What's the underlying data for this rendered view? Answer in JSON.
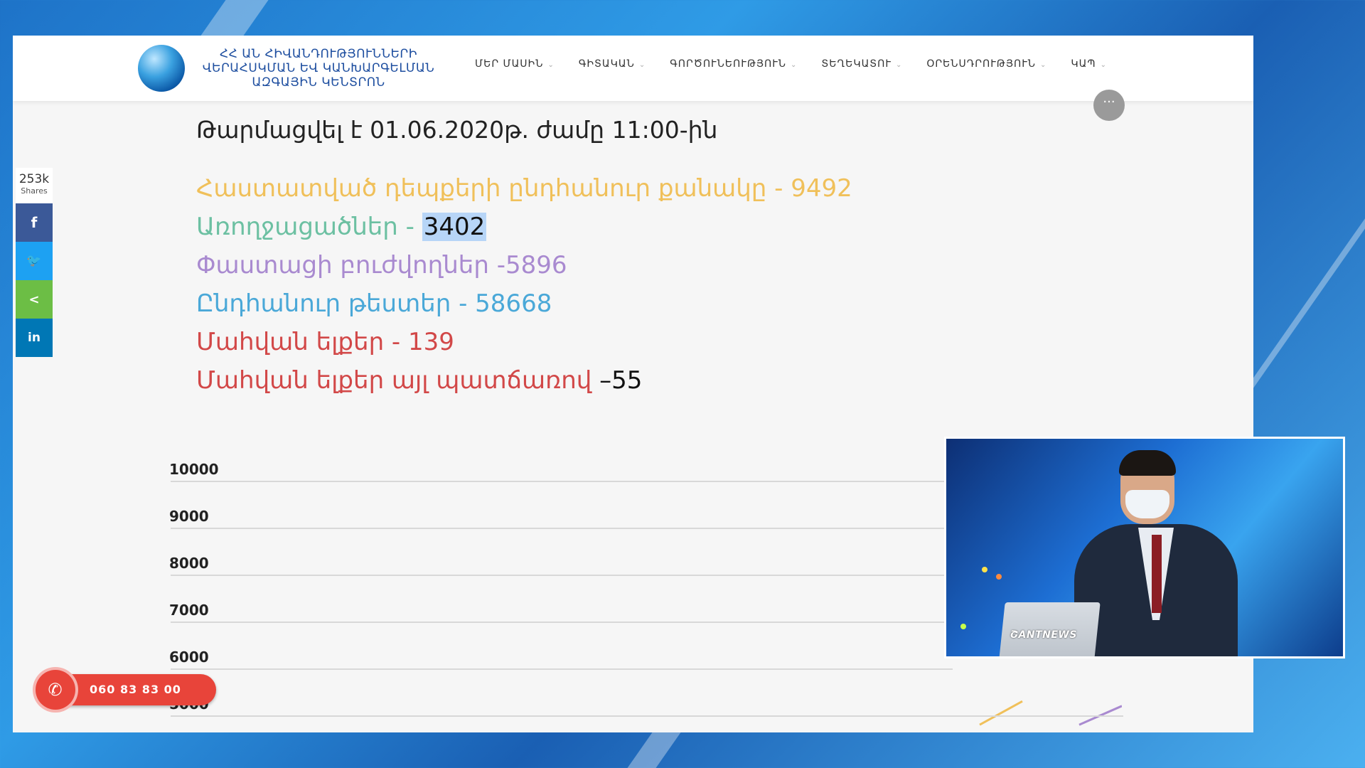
{
  "header": {
    "logo_text": "ՀՀ ԱՆ ՀԻՎԱՆԴՈՒԹՅՈՒՆՆԵՐԻ ՎԵՐԱՀՍԿՄԱՆ ԵՎ ԿԱՆԽԱՐԳԵԼՄԱՆ ԱԶԳԱՅԻՆ ԿԵՆՏՐՈՆ",
    "nav": [
      {
        "label": "ՄԵՐ ՄԱՍԻՆ"
      },
      {
        "label": "ԳԻՏԱԿԱՆ"
      },
      {
        "label": "ԳՈՐԾՈՒՆԵՈՒԹՅՈՒՆ"
      },
      {
        "label": "ՏԵՂԵԿԱՏՈՒ"
      },
      {
        "label": "ՕՐԵՆՍԴՐՈՒԹՅՈՒՆ"
      },
      {
        "label": "ԿԱՊ"
      }
    ],
    "badge_text": "···"
  },
  "share": {
    "count": "253k",
    "count_label": "Shares",
    "facebook": "f",
    "twitter": "🐦",
    "share": "<",
    "linkedin": "in"
  },
  "updated": "Թարմացվել է 01.06.2020թ. ժամը 11:00-ին",
  "stats": [
    {
      "label": "Հաստատված դեպքերի ընդհանուր քանակը - ",
      "value": "9492"
    },
    {
      "label": "Առողջացածներ - ",
      "value": "3402"
    },
    {
      "label": "Փաստացի բուժվողներ -",
      "value": "5896"
    },
    {
      "label": "Ընդհանուր թեստեր - ",
      "value": "58668"
    },
    {
      "label": "Մահվան ելքեր - ",
      "value": "139"
    },
    {
      "label": "Մահվան ելքեր այլ պատճառով ",
      "value": "–55"
    }
  ],
  "chart_data": {
    "type": "line",
    "y_ticks": [
      "10000",
      "9000",
      "8000",
      "7000",
      "6000",
      "5000"
    ],
    "ylim": [
      5000,
      10000
    ],
    "series": [
      {
        "color": "#f0c05a",
        "points": [
          [
            0.0,
            4800
          ],
          [
            1.0,
            5300
          ]
        ]
      },
      {
        "color": "#a98ad0",
        "points": [
          [
            0.0,
            4800
          ],
          [
            1.0,
            5200
          ]
        ]
      }
    ],
    "colors": {
      "grid": "#d8d8d8"
    }
  },
  "phone": {
    "number": "060 83 83 00",
    "icon": "phone-icon"
  },
  "video": {
    "brand": "ՇANTNEWS"
  },
  "colors": {
    "accent_red": "#e8443a",
    "facebook": "#3b5998",
    "twitter": "#1da1f2",
    "share": "#6cbe45",
    "linkedin": "#0077b5"
  }
}
